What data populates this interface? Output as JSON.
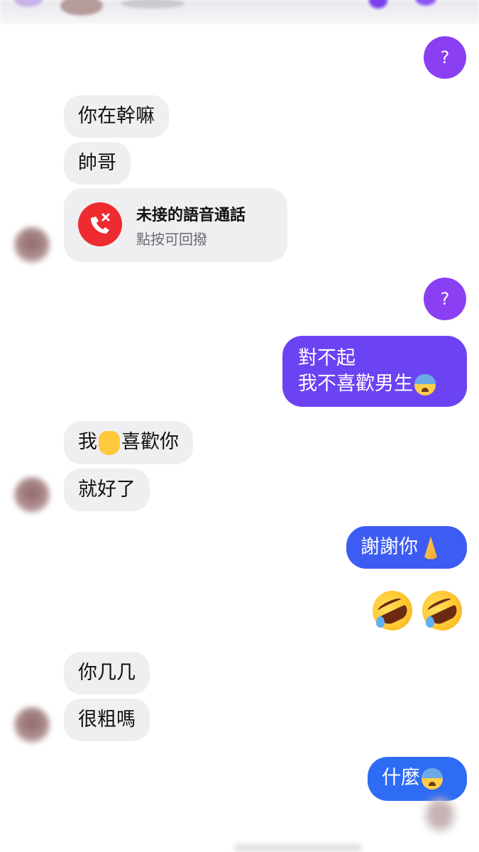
{
  "conversation": {
    "messages": [
      {
        "id": "q1",
        "side": "out",
        "type": "reaction",
        "text": "?"
      },
      {
        "id": "m1",
        "side": "in",
        "text": "你在幹嘛"
      },
      {
        "id": "m2",
        "side": "in",
        "text": "帥哥"
      },
      {
        "id": "call",
        "side": "in",
        "type": "missed-call",
        "title": "未接的語音通話",
        "subtitle": "點按可回撥"
      },
      {
        "id": "q2",
        "side": "out",
        "type": "reaction",
        "text": "?"
      },
      {
        "id": "m3",
        "side": "out",
        "line1": "對不起",
        "line2": "我不喜歡男生"
      },
      {
        "id": "m4",
        "side": "in",
        "before": "我",
        "after": "喜歡你"
      },
      {
        "id": "m5",
        "side": "in",
        "text": "就好了"
      },
      {
        "id": "m6",
        "side": "out",
        "text": "謝謝你"
      },
      {
        "id": "m7",
        "side": "out",
        "type": "emoji",
        "emoji": "rofl-rofl"
      },
      {
        "id": "m8",
        "side": "in",
        "text": "你几几"
      },
      {
        "id": "m9",
        "side": "in",
        "text": "很粗嗎"
      },
      {
        "id": "m10",
        "side": "out",
        "text": "什麼"
      }
    ]
  },
  "colors": {
    "incoming_bg": "#efeff2",
    "outgoing_purple": "#6b43f3",
    "outgoing_blue": "#2f6cf5",
    "reaction": "#8a3ff2",
    "missed_call_red": "#ee2b2f"
  }
}
